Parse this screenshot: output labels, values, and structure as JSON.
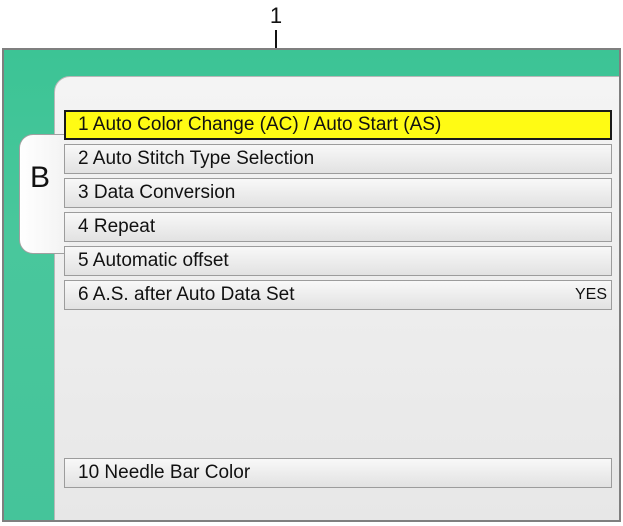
{
  "callout": {
    "label": "1"
  },
  "tab": {
    "label": "B"
  },
  "menu": {
    "items": [
      {
        "label": "1 Auto Color Change (AC) / Auto Start (AS)",
        "value": ""
      },
      {
        "label": "2 Auto Stitch Type Selection",
        "value": ""
      },
      {
        "label": "3 Data Conversion",
        "value": ""
      },
      {
        "label": "4 Repeat",
        "value": ""
      },
      {
        "label": "5 Automatic offset",
        "value": ""
      },
      {
        "label": "6 A.S. after Auto Data Set",
        "value": "YES"
      }
    ],
    "bottom_item": {
      "label": "10 Needle Bar Color"
    }
  },
  "colors": {
    "screen_bg": "#45c49a",
    "selected_row": "#fffb14",
    "panel": "#ececec"
  }
}
